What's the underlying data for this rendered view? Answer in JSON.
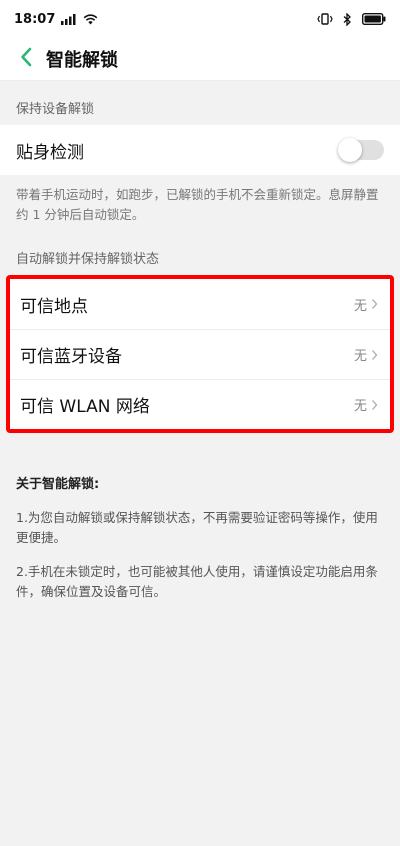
{
  "status_bar": {
    "time": "18:07"
  },
  "header": {
    "title": "智能解锁"
  },
  "keep_unlocked": {
    "section_title": "保持设备解锁",
    "on_body_label": "贴身检测",
    "on_body_enabled": false,
    "description": "带着手机运动时，如跑步，已解锁的手机不会重新锁定。息屏静置约 1 分钟后自动锁定。"
  },
  "auto_unlock": {
    "section_title": "自动解锁并保持解锁状态",
    "items": [
      {
        "label": "可信地点",
        "value": "无"
      },
      {
        "label": "可信蓝牙设备",
        "value": "无"
      },
      {
        "label": "可信 WLAN 网络",
        "value": "无"
      }
    ]
  },
  "about": {
    "title": "关于智能解锁:",
    "items": [
      "1.为您自动解锁或保持解锁状态，不再需要验证密码等操作，使用更便捷。",
      "2.手机在未锁定时，也可能被其他人使用，请谨慎设定功能启用条件，确保位置及设备可信。"
    ]
  },
  "colors": {
    "accent": "#2bb673",
    "highlight_border": "#ff0000",
    "background": "#f2f2f2"
  }
}
